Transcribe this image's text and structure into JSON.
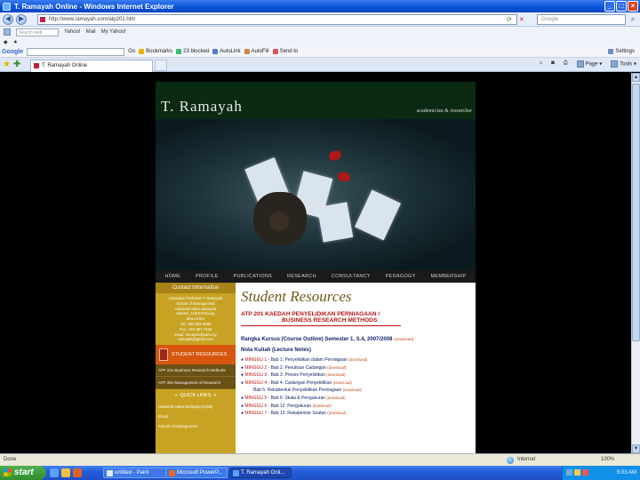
{
  "window": {
    "title": "T. Ramayah Online - Windows Internet Explorer",
    "controls": [
      "_",
      "□",
      "×"
    ]
  },
  "address_bar": {
    "url": "http://www.ramayah.com/atp201.htm",
    "search_placeholder": "Google"
  },
  "toolbar2": {
    "search_field": "Search web",
    "items": [
      "Yahoo!",
      "Mail",
      "My Yahoo!"
    ]
  },
  "toolbar3": {
    "items": [
      "◆",
      "★"
    ]
  },
  "google_bar": {
    "label": "Google",
    "go_label": "Go",
    "links": [
      "Bookmarks",
      "23 blocked",
      "AutoLink",
      "AutoFill",
      "Send to"
    ],
    "settings_label": "Settings"
  },
  "tabs": {
    "active_tab": "T. Ramayah Online",
    "commands": [
      "Page",
      "Tools"
    ]
  },
  "site": {
    "title": "T. Ramayah",
    "tagline": "academician & researcher",
    "nav": [
      "HOME",
      "PROFILE",
      "PUBLICATIONS",
      "RESEARCH",
      "CONSULTANCY",
      "PEDAGOGY",
      "MEMBERSHIP"
    ],
    "contact": {
      "heading": "Contact Information",
      "lines": [
        "Associate Professor T. Ramayah",
        "School of Management",
        "Universiti Sains Malaysia",
        "Minden, 11800 Penang",
        "MALAYSIA",
        "Tel : 604 653 3889",
        "Fax : 604 657 7448",
        "email: ramayah@usm.my",
        "ramayah@gmail.com"
      ]
    },
    "student_resources_label": "STUDENT RESOURCES",
    "sidebar_links": [
      "ATP 201 Business Research Methods",
      "ATP 391 Management of Research"
    ],
    "quick_links_heading": "QUICK LINKS",
    "quick_links": [
      "Universiti Sains Malaysia (USM)",
      "Email",
      "School of Management"
    ],
    "main": {
      "heading": "Student Resources",
      "course_title_1": "ATP 201  KAEDAH PENYELIDIKAN PERNIAGAAN /",
      "course_title_2": "BUSINESS RESEARCH METHODS",
      "rangka": "Rangka Kursus (Course Outline) Semester 1, S.4, 2007/2008",
      "rangka_dl": "(download)",
      "nota_heading": "Nota Kuliah (Lecture Notes)",
      "modules": [
        {
          "week": "MINGGU 1",
          "bab": " - Bab 1: Penyelidikan dalam Perniagaan",
          "dl": "(download)",
          "sub": false
        },
        {
          "week": "MINGGU 2",
          "bab": " - Bab 2: Penulisan Cadangan",
          "dl": "(download)",
          "sub": false
        },
        {
          "week": "MINGGU 3",
          "bab": " - Bab 3: Proses Penyelidikan",
          "dl": "(download)",
          "sub": false
        },
        {
          "week": "MINGGU 4",
          "bab": " - Bab 4: Cadangan Penyelidikan",
          "dl": "(download)",
          "sub": false
        },
        {
          "week": "",
          "bab": "Bab 5: Rekabentuk Penyelidikan Perniagaan",
          "dl": "(download)",
          "sub": true
        },
        {
          "week": "MINGGU 5",
          "bab": " - Bab 6: Skala & Pengukuran",
          "dl": "(download)",
          "sub": false
        },
        {
          "week": "MINGGU 6",
          "bab": " - Bab 12: Pengukuran",
          "dl": "(download)",
          "sub": false
        },
        {
          "week": "MINGGU 7",
          "bab": " - Bab 13: Rekabentuk Soalan",
          "dl": "(download)",
          "sub": false
        }
      ]
    }
  },
  "status_bar": {
    "text": "Done",
    "zone": "Internet",
    "zoom": "100%"
  },
  "taskbar": {
    "start_label": "start",
    "buttons": [
      "untitled - Paint",
      "Microsoft PowerP...",
      "T. Ramayah Onli..."
    ],
    "clock": "5:03 AM"
  },
  "colors": {
    "titlebar": "#0a52d6",
    "site_header": "#0a2a12",
    "sidebar_gold": "#c8a323",
    "student_resources_orange": "#d7560f",
    "course_red": "#b81414",
    "navy": "#14246a"
  }
}
